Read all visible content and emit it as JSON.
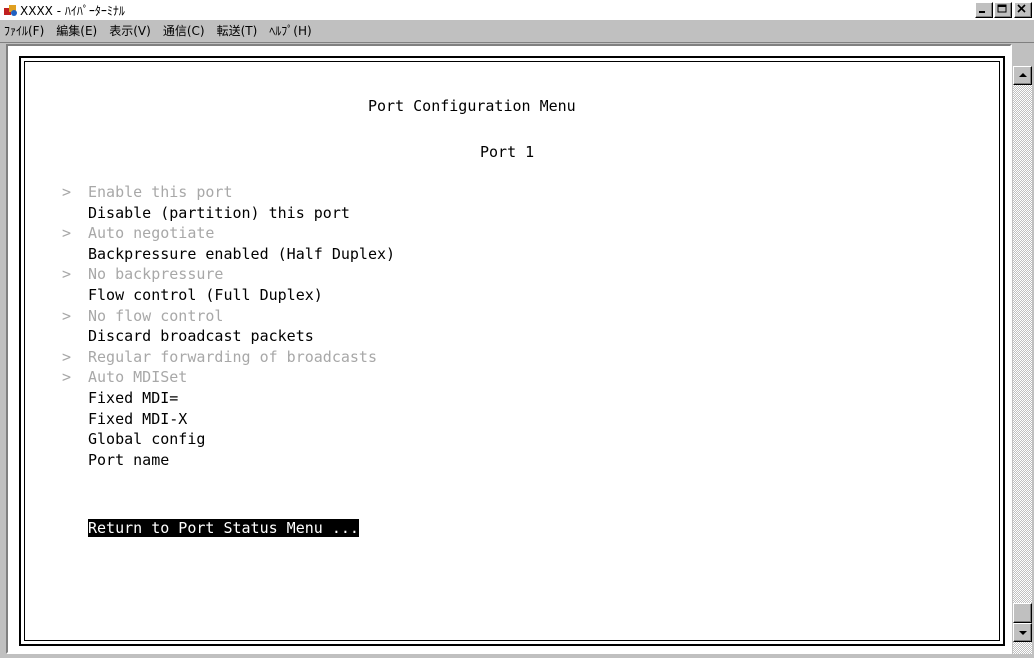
{
  "window": {
    "title": "XXXX - ﾊｲﾊﾟｰﾀｰﾐﾅﾙ",
    "icon": "hyperterminal-icon",
    "buttons": [
      "minimize",
      "maximize",
      "close"
    ]
  },
  "menubar": {
    "items": [
      "ﾌｧｲﾙ(F)",
      "編集(E)",
      "表示(V)",
      "通信(C)",
      "転送(T)",
      "ﾍﾙﾌﾟ(H)"
    ]
  },
  "terminal": {
    "heading": "Port Configuration Menu",
    "subheading": "Port 1",
    "options": [
      {
        "label": "Enable this port",
        "current": true
      },
      {
        "label": "Disable (partition) this port",
        "current": false
      },
      {
        "label": "Auto negotiate",
        "current": true
      },
      {
        "label": "Backpressure enabled (Half Duplex)",
        "current": false
      },
      {
        "label": "No backpressure",
        "current": true
      },
      {
        "label": "Flow control (Full Duplex)",
        "current": false
      },
      {
        "label": "No flow control",
        "current": true
      },
      {
        "label": "Discard broadcast packets",
        "current": false
      },
      {
        "label": "Regular forwarding of broadcasts",
        "current": true
      },
      {
        "label": "Auto MDISet",
        "current": true
      },
      {
        "label": "Fixed MDI=",
        "current": false
      },
      {
        "label": "Fixed MDI-X",
        "current": false
      },
      {
        "label": "Global config",
        "current": false
      },
      {
        "label": "Port name",
        "current": false
      }
    ],
    "marker": ">",
    "return_option": "Return to Port Status Menu ..."
  },
  "colors": {
    "selection_bg": "#000000",
    "dim_text": "#a8a8a8",
    "background": "#ffffff",
    "chrome": "#c0c0c0"
  }
}
